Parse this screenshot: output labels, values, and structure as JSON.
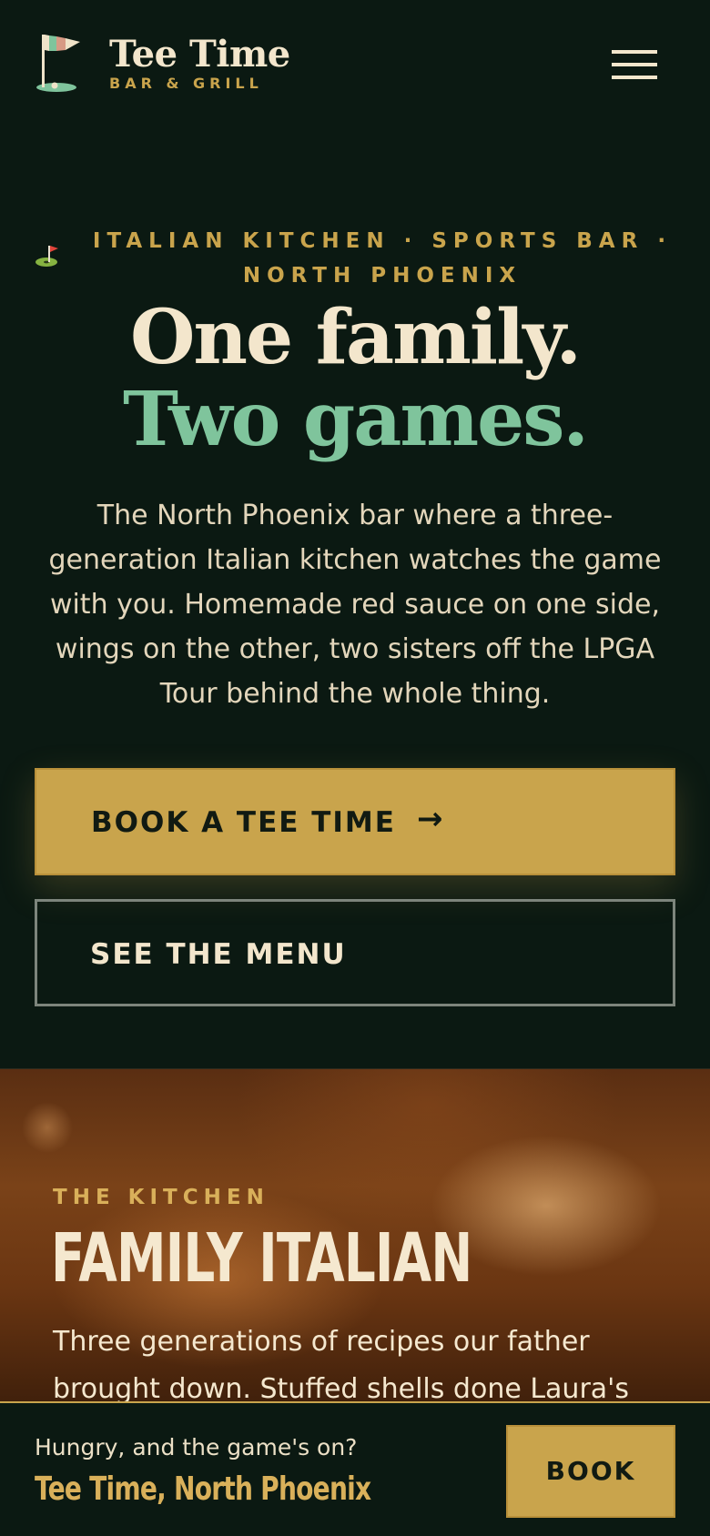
{
  "header": {
    "brand_name": "Tee Time",
    "brand_sub": "BAR & GRILL",
    "logo_icon": "golf-flag-icon",
    "menu_icon": "hamburger-menu-icon"
  },
  "hero": {
    "eyebrow_icon": "golf-hole-icon",
    "eyebrow": "ITALIAN KITCHEN · SPORTS BAR · NORTH PHOENIX",
    "headline_1": "One family.",
    "headline_2": "Two games.",
    "intro": "The North Phoenix bar where a three-generation Italian kitchen watches the game with you. Homemade red sauce on one side, wings on the other, two sisters off the LPGA Tour behind the whole thing.",
    "primary_cta": "BOOK A TEE TIME",
    "primary_cta_icon": "arrow-right-icon",
    "secondary_cta": "SEE THE MENU"
  },
  "kitchen": {
    "eyebrow": "THE KITCHEN",
    "title": "FAMILY ITALIAN",
    "text": "Three generations of recipes our father brought down. Stuffed shells done Laura's"
  },
  "sticky_bar": {
    "question": "Hungry, and the game's on?",
    "place": "Tee Time, North Phoenix",
    "book_label": "BOOK"
  },
  "colors": {
    "background": "#0b1912",
    "cream": "#f3e6cc",
    "gold": "#c9a44c",
    "green": "#7fc49c"
  }
}
